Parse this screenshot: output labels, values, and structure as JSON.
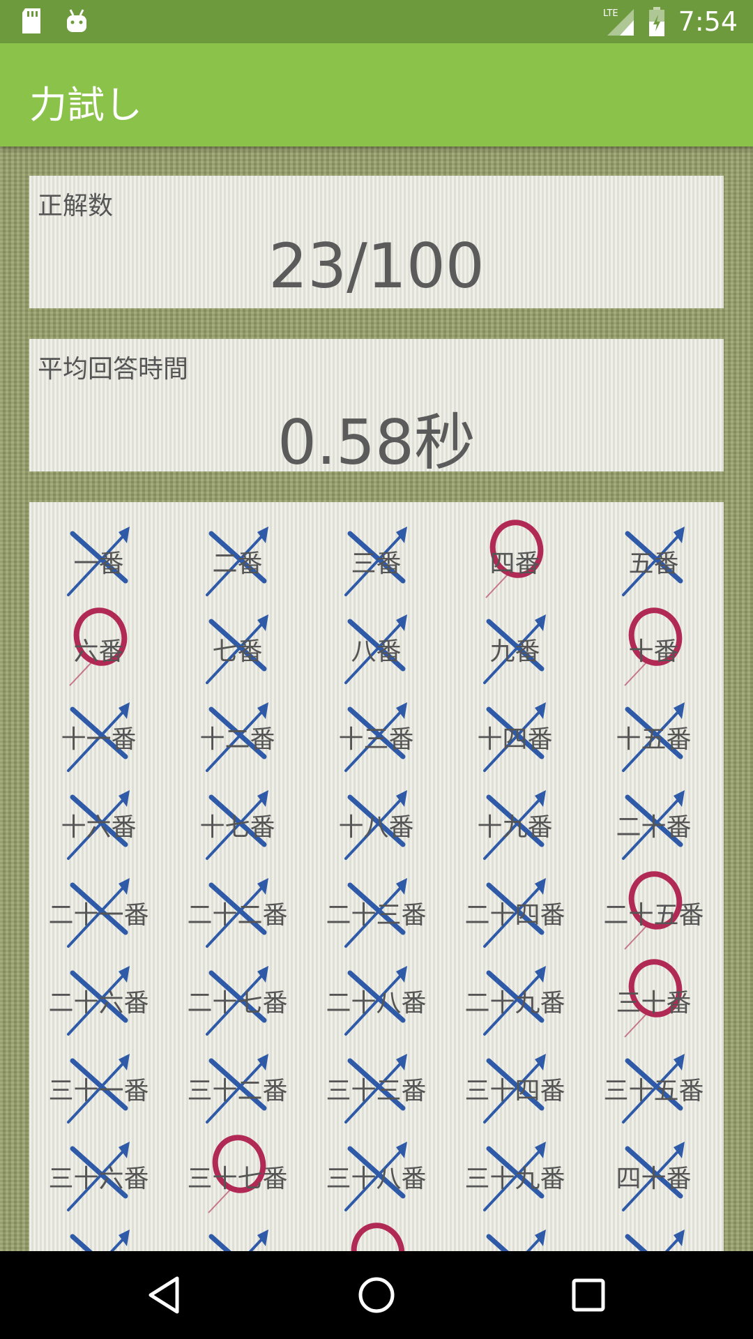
{
  "status_bar": {
    "time": "7:54",
    "network": "LTE"
  },
  "app_bar": {
    "title": "力試し"
  },
  "correct": {
    "label": "正解数",
    "value": "23/100"
  },
  "avg_time": {
    "label": "平均回答時間",
    "value": "0.58秒"
  },
  "colors": {
    "correct_mark": "#b02a55",
    "wrong_mark": "#2f5aa8",
    "app_bar": "#8bc34a",
    "status_bar": "#6e9a3e"
  },
  "results": [
    {
      "label": "一番",
      "mark": "x"
    },
    {
      "label": "二番",
      "mark": "x"
    },
    {
      "label": "三番",
      "mark": "x"
    },
    {
      "label": "四番",
      "mark": "o"
    },
    {
      "label": "五番",
      "mark": "x"
    },
    {
      "label": "六番",
      "mark": "o"
    },
    {
      "label": "七番",
      "mark": "x"
    },
    {
      "label": "八番",
      "mark": "x"
    },
    {
      "label": "九番",
      "mark": "x"
    },
    {
      "label": "十番",
      "mark": "o"
    },
    {
      "label": "十一番",
      "mark": "x"
    },
    {
      "label": "十二番",
      "mark": "x"
    },
    {
      "label": "十三番",
      "mark": "x"
    },
    {
      "label": "十四番",
      "mark": "x"
    },
    {
      "label": "十五番",
      "mark": "x"
    },
    {
      "label": "十六番",
      "mark": "x"
    },
    {
      "label": "十七番",
      "mark": "x"
    },
    {
      "label": "十八番",
      "mark": "x"
    },
    {
      "label": "十九番",
      "mark": "x"
    },
    {
      "label": "二十番",
      "mark": "x"
    },
    {
      "label": "二十一番",
      "mark": "x"
    },
    {
      "label": "二十二番",
      "mark": "x"
    },
    {
      "label": "二十三番",
      "mark": "x"
    },
    {
      "label": "二十四番",
      "mark": "x"
    },
    {
      "label": "二十五番",
      "mark": "o"
    },
    {
      "label": "二十六番",
      "mark": "x"
    },
    {
      "label": "二十七番",
      "mark": "x"
    },
    {
      "label": "二十八番",
      "mark": "x"
    },
    {
      "label": "二十九番",
      "mark": "x"
    },
    {
      "label": "三十番",
      "mark": "o"
    },
    {
      "label": "三十一番",
      "mark": "x"
    },
    {
      "label": "三十二番",
      "mark": "x"
    },
    {
      "label": "三十三番",
      "mark": "x"
    },
    {
      "label": "三十四番",
      "mark": "x"
    },
    {
      "label": "三十五番",
      "mark": "x"
    },
    {
      "label": "三十六番",
      "mark": "x"
    },
    {
      "label": "三十七番",
      "mark": "o"
    },
    {
      "label": "三十八番",
      "mark": "x"
    },
    {
      "label": "三十九番",
      "mark": "x"
    },
    {
      "label": "四十番",
      "mark": "x"
    },
    {
      "label": "",
      "mark": "x"
    },
    {
      "label": "",
      "mark": "x"
    },
    {
      "label": "",
      "mark": "o"
    },
    {
      "label": "",
      "mark": "x"
    },
    {
      "label": "",
      "mark": "x"
    }
  ],
  "nav_bar": {
    "back": "back-icon",
    "home": "home-icon",
    "recents": "recents-icon"
  }
}
